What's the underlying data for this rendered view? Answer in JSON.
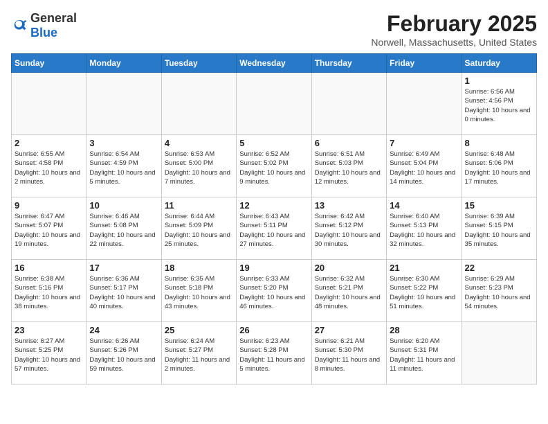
{
  "logo": {
    "general": "General",
    "blue": "Blue"
  },
  "title": {
    "month_year": "February 2025",
    "location": "Norwell, Massachusetts, United States"
  },
  "days_of_week": [
    "Sunday",
    "Monday",
    "Tuesday",
    "Wednesday",
    "Thursday",
    "Friday",
    "Saturday"
  ],
  "weeks": [
    [
      {
        "day": "",
        "info": ""
      },
      {
        "day": "",
        "info": ""
      },
      {
        "day": "",
        "info": ""
      },
      {
        "day": "",
        "info": ""
      },
      {
        "day": "",
        "info": ""
      },
      {
        "day": "",
        "info": ""
      },
      {
        "day": "1",
        "info": "Sunrise: 6:56 AM\nSunset: 4:56 PM\nDaylight: 10 hours and 0 minutes."
      }
    ],
    [
      {
        "day": "2",
        "info": "Sunrise: 6:55 AM\nSunset: 4:58 PM\nDaylight: 10 hours and 2 minutes."
      },
      {
        "day": "3",
        "info": "Sunrise: 6:54 AM\nSunset: 4:59 PM\nDaylight: 10 hours and 5 minutes."
      },
      {
        "day": "4",
        "info": "Sunrise: 6:53 AM\nSunset: 5:00 PM\nDaylight: 10 hours and 7 minutes."
      },
      {
        "day": "5",
        "info": "Sunrise: 6:52 AM\nSunset: 5:02 PM\nDaylight: 10 hours and 9 minutes."
      },
      {
        "day": "6",
        "info": "Sunrise: 6:51 AM\nSunset: 5:03 PM\nDaylight: 10 hours and 12 minutes."
      },
      {
        "day": "7",
        "info": "Sunrise: 6:49 AM\nSunset: 5:04 PM\nDaylight: 10 hours and 14 minutes."
      },
      {
        "day": "8",
        "info": "Sunrise: 6:48 AM\nSunset: 5:06 PM\nDaylight: 10 hours and 17 minutes."
      }
    ],
    [
      {
        "day": "9",
        "info": "Sunrise: 6:47 AM\nSunset: 5:07 PM\nDaylight: 10 hours and 19 minutes."
      },
      {
        "day": "10",
        "info": "Sunrise: 6:46 AM\nSunset: 5:08 PM\nDaylight: 10 hours and 22 minutes."
      },
      {
        "day": "11",
        "info": "Sunrise: 6:44 AM\nSunset: 5:09 PM\nDaylight: 10 hours and 25 minutes."
      },
      {
        "day": "12",
        "info": "Sunrise: 6:43 AM\nSunset: 5:11 PM\nDaylight: 10 hours and 27 minutes."
      },
      {
        "day": "13",
        "info": "Sunrise: 6:42 AM\nSunset: 5:12 PM\nDaylight: 10 hours and 30 minutes."
      },
      {
        "day": "14",
        "info": "Sunrise: 6:40 AM\nSunset: 5:13 PM\nDaylight: 10 hours and 32 minutes."
      },
      {
        "day": "15",
        "info": "Sunrise: 6:39 AM\nSunset: 5:15 PM\nDaylight: 10 hours and 35 minutes."
      }
    ],
    [
      {
        "day": "16",
        "info": "Sunrise: 6:38 AM\nSunset: 5:16 PM\nDaylight: 10 hours and 38 minutes."
      },
      {
        "day": "17",
        "info": "Sunrise: 6:36 AM\nSunset: 5:17 PM\nDaylight: 10 hours and 40 minutes."
      },
      {
        "day": "18",
        "info": "Sunrise: 6:35 AM\nSunset: 5:18 PM\nDaylight: 10 hours and 43 minutes."
      },
      {
        "day": "19",
        "info": "Sunrise: 6:33 AM\nSunset: 5:20 PM\nDaylight: 10 hours and 46 minutes."
      },
      {
        "day": "20",
        "info": "Sunrise: 6:32 AM\nSunset: 5:21 PM\nDaylight: 10 hours and 48 minutes."
      },
      {
        "day": "21",
        "info": "Sunrise: 6:30 AM\nSunset: 5:22 PM\nDaylight: 10 hours and 51 minutes."
      },
      {
        "day": "22",
        "info": "Sunrise: 6:29 AM\nSunset: 5:23 PM\nDaylight: 10 hours and 54 minutes."
      }
    ],
    [
      {
        "day": "23",
        "info": "Sunrise: 6:27 AM\nSunset: 5:25 PM\nDaylight: 10 hours and 57 minutes."
      },
      {
        "day": "24",
        "info": "Sunrise: 6:26 AM\nSunset: 5:26 PM\nDaylight: 10 hours and 59 minutes."
      },
      {
        "day": "25",
        "info": "Sunrise: 6:24 AM\nSunset: 5:27 PM\nDaylight: 11 hours and 2 minutes."
      },
      {
        "day": "26",
        "info": "Sunrise: 6:23 AM\nSunset: 5:28 PM\nDaylight: 11 hours and 5 minutes."
      },
      {
        "day": "27",
        "info": "Sunrise: 6:21 AM\nSunset: 5:30 PM\nDaylight: 11 hours and 8 minutes."
      },
      {
        "day": "28",
        "info": "Sunrise: 6:20 AM\nSunset: 5:31 PM\nDaylight: 11 hours and 11 minutes."
      },
      {
        "day": "",
        "info": ""
      }
    ]
  ]
}
